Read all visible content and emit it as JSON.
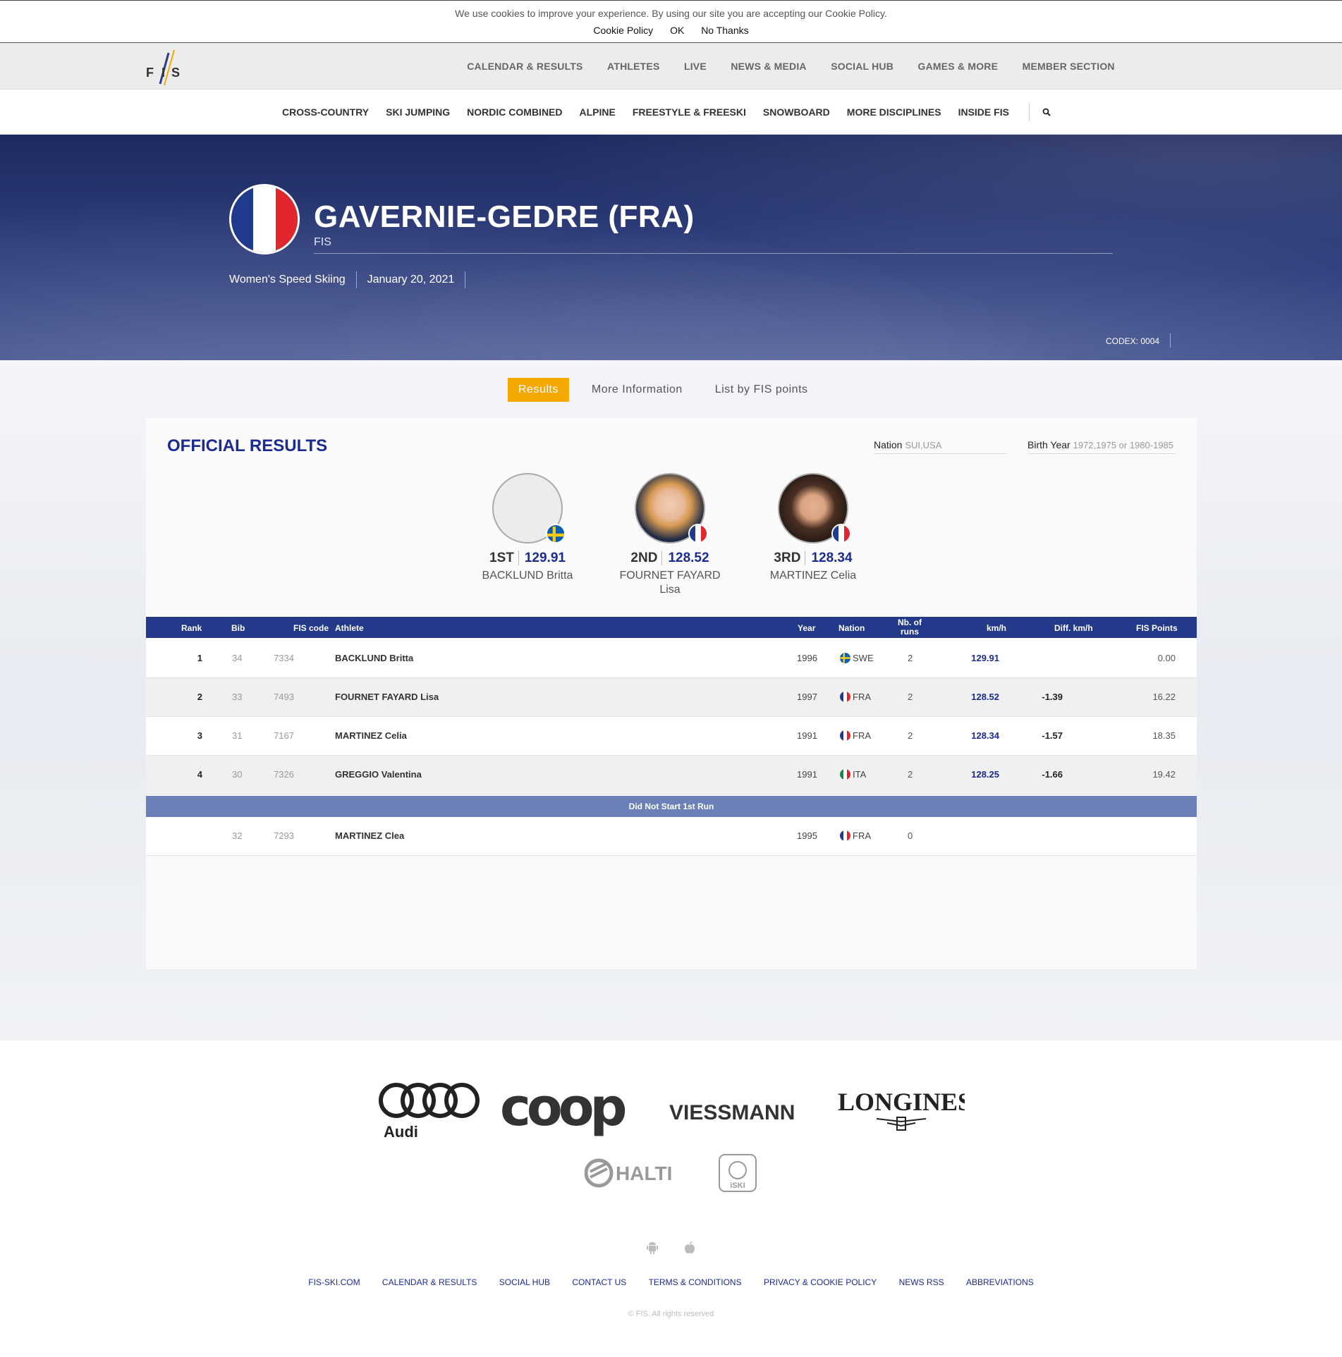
{
  "cookie": {
    "text": "We use cookies to improve your experience. By using our site you are accepting our Cookie Policy.",
    "policy_link": "Cookie Policy",
    "ok": "OK",
    "no_thanks": "No Thanks"
  },
  "logo_text": "FIS",
  "main_nav": [
    "CALENDAR & RESULTS",
    "ATHLETES",
    "LIVE",
    "NEWS & MEDIA",
    "SOCIAL HUB",
    "GAMES & MORE",
    "MEMBER SECTION"
  ],
  "sub_nav": [
    "CROSS-COUNTRY",
    "SKI JUMPING",
    "NORDIC COMBINED",
    "ALPINE",
    "FREESTYLE & FREESKI",
    "SNOWBOARD",
    "MORE DISCIPLINES",
    "INSIDE FIS"
  ],
  "hero": {
    "title": "GAVERNIE-GEDRE (FRA)",
    "subtitle": "FIS",
    "event": "Women's Speed Skiing",
    "date": "January 20, 2021",
    "codex": "CODEX: 0004"
  },
  "tabs": [
    "Results",
    "More Information",
    "List by FIS points"
  ],
  "results": {
    "title": "OFFICIAL RESULTS",
    "filter_nation_label": "Nation",
    "filter_nation_placeholder": "SUI,USA",
    "filter_birth_label": "Birth Year",
    "filter_birth_placeholder": "1972,1975 or 1980-1985"
  },
  "podium": [
    {
      "rank": "1ST",
      "speed": "129.91",
      "name": "BACKLUND Britta",
      "flag": "swe"
    },
    {
      "rank": "2ND",
      "speed": "128.52",
      "name": "FOURNET FAYARD Lisa",
      "flag": "fra"
    },
    {
      "rank": "3RD",
      "speed": "128.34",
      "name": "MARTINEZ Celia",
      "flag": "fra"
    }
  ],
  "table": {
    "headers": {
      "rank": "Rank",
      "bib": "Bib",
      "fiscode": "FIS code",
      "athlete": "Athlete",
      "year": "Year",
      "nation": "Nation",
      "runs": "Nb. of runs",
      "kmh": "km/h",
      "diff": "Diff. km/h",
      "points": "FIS Points"
    },
    "rows": [
      {
        "rank": "1",
        "bib": "34",
        "fiscode": "7334",
        "athlete": "BACKLUND Britta",
        "year": "1996",
        "nation": "SWE",
        "runs": "2",
        "kmh": "129.91",
        "diff": "",
        "points": "0.00"
      },
      {
        "rank": "2",
        "bib": "33",
        "fiscode": "7493",
        "athlete": "FOURNET FAYARD Lisa",
        "year": "1997",
        "nation": "FRA",
        "runs": "2",
        "kmh": "128.52",
        "diff": "-1.39",
        "points": "16.22"
      },
      {
        "rank": "3",
        "bib": "31",
        "fiscode": "7167",
        "athlete": "MARTINEZ Celia",
        "year": "1991",
        "nation": "FRA",
        "runs": "2",
        "kmh": "128.34",
        "diff": "-1.57",
        "points": "18.35"
      },
      {
        "rank": "4",
        "bib": "30",
        "fiscode": "7326",
        "athlete": "GREGGIO Valentina",
        "year": "1991",
        "nation": "ITA",
        "runs": "2",
        "kmh": "128.25",
        "diff": "-1.66",
        "points": "19.42"
      }
    ],
    "dns_label": "Did Not Start 1st Run",
    "dns_rows": [
      {
        "rank": "",
        "bib": "32",
        "fiscode": "7293",
        "athlete": "MARTINEZ Clea",
        "year": "1995",
        "nation": "FRA",
        "runs": "0",
        "kmh": "",
        "diff": "",
        "points": ""
      }
    ]
  },
  "sponsors": [
    "Audi",
    "coop",
    "VIESSMANN",
    "LONGINES",
    "HALTI",
    "iSKI"
  ],
  "footer_links": [
    "FIS-SKI.COM",
    "CALENDAR & RESULTS",
    "SOCIAL HUB",
    "CONTACT US",
    "TERMS & CONDITIONS",
    "PRIVACY & COOKIE POLICY",
    "NEWS RSS",
    "ABBREVIATIONS"
  ],
  "copyright": "© FIS. All rights reserved",
  "colors": {
    "accent": "#f5a800",
    "brand_blue": "#1b2b8f",
    "table_header": "#23398a",
    "dns_bar": "#6c80b8"
  }
}
